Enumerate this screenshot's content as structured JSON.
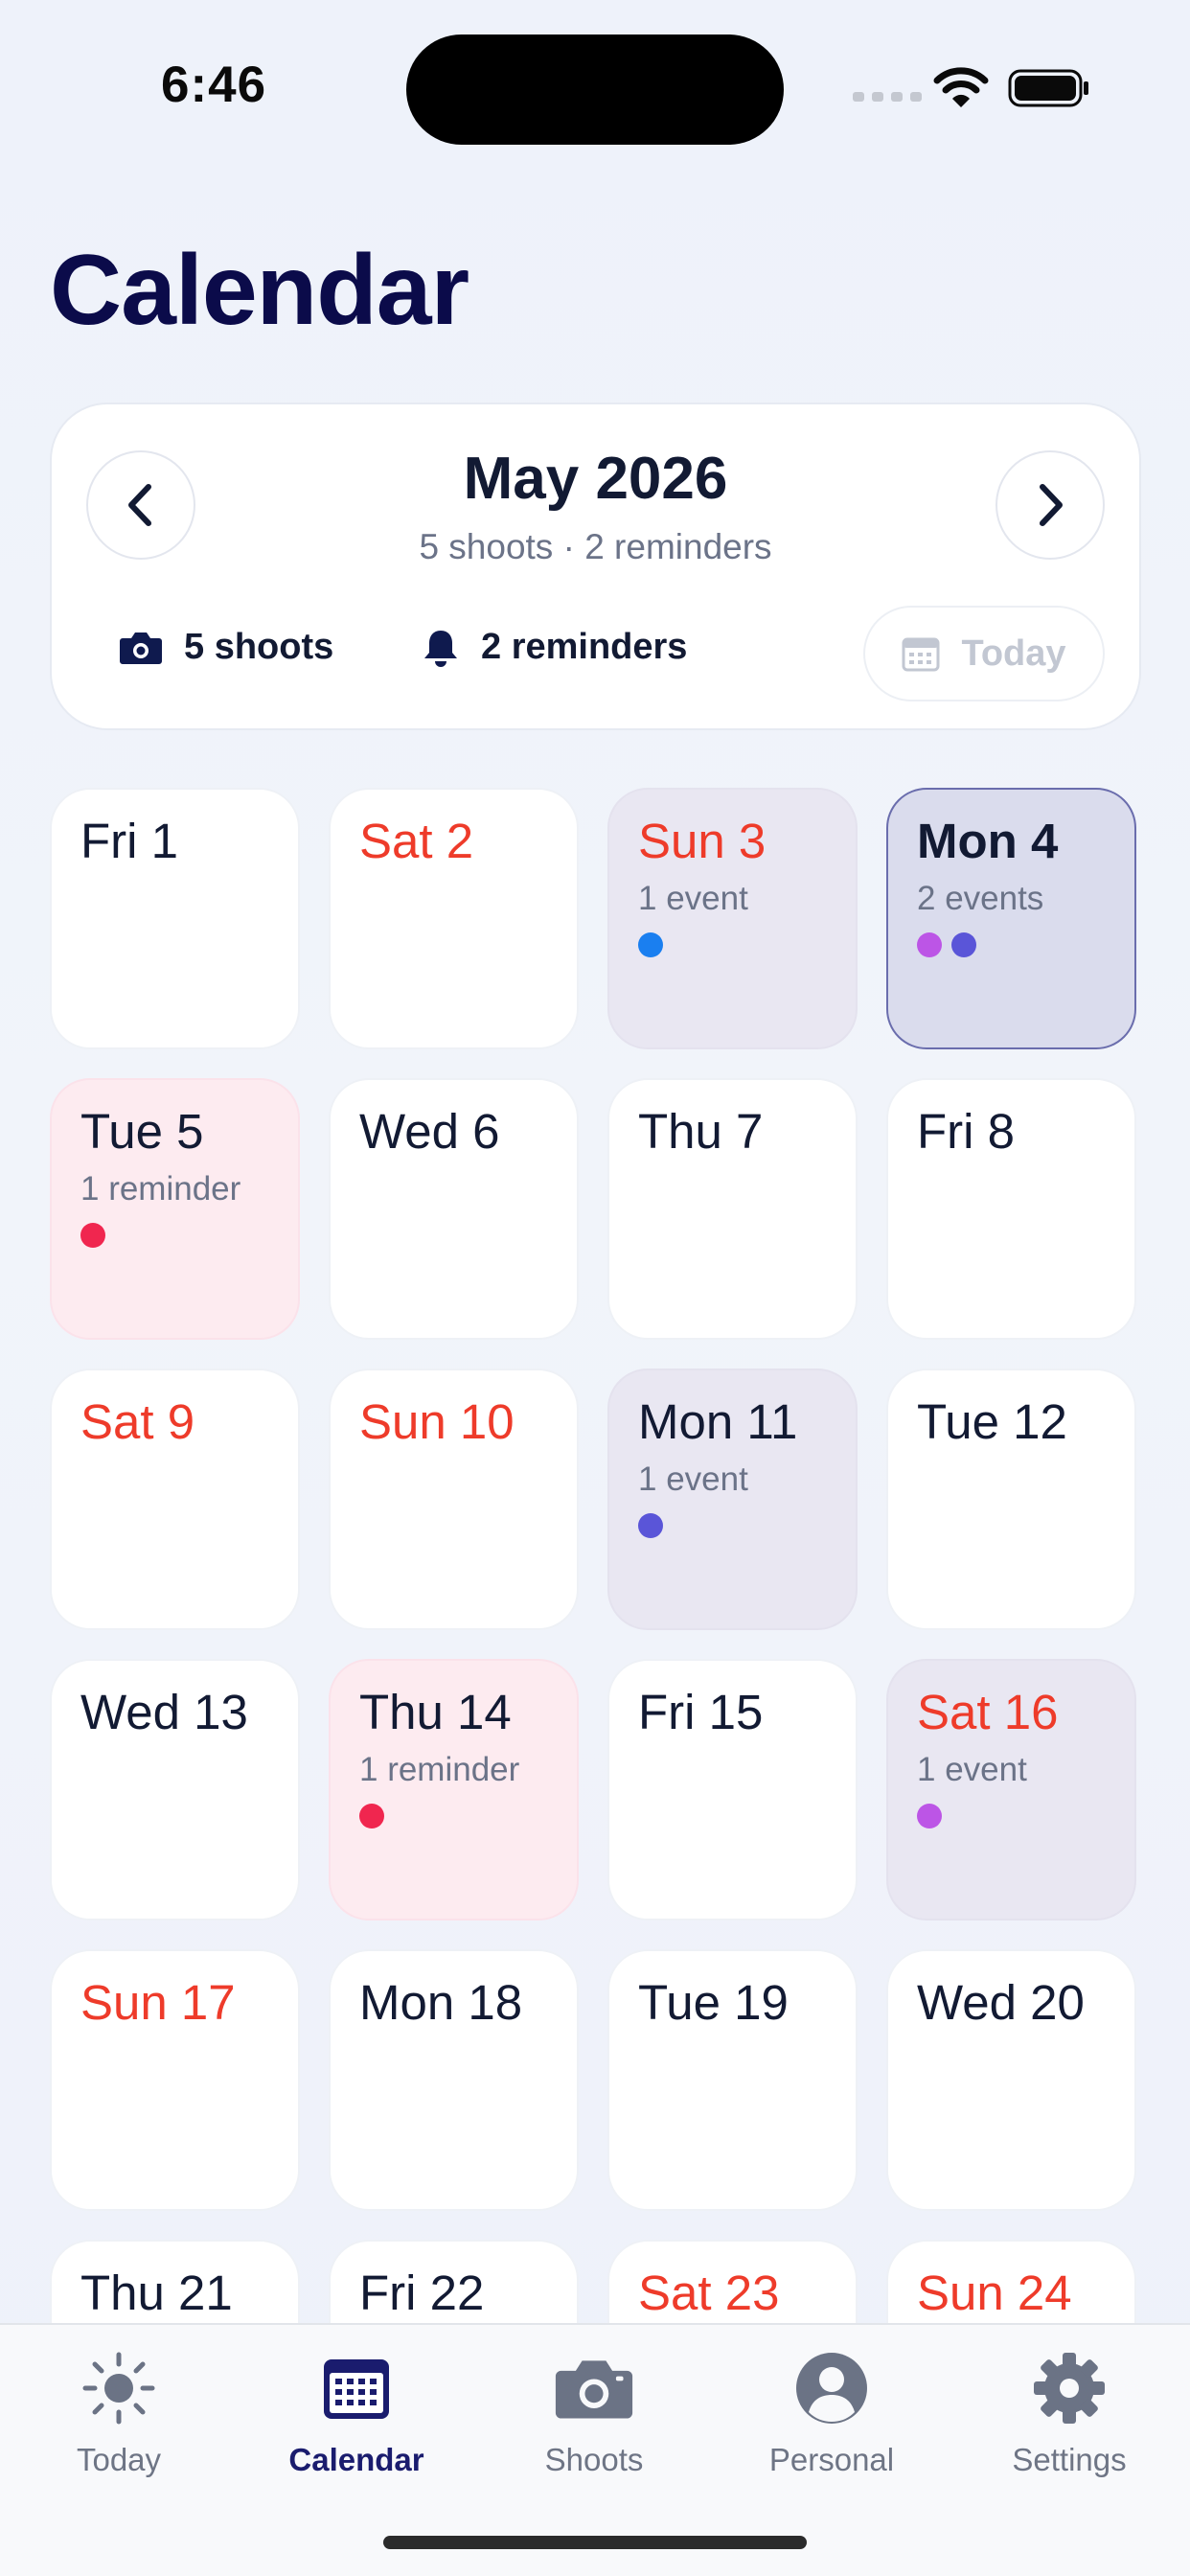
{
  "status_bar": {
    "time": "6:46"
  },
  "header": {
    "title": "Calendar"
  },
  "month_card": {
    "month": "May 2026",
    "subtitle": "5 shoots · 2 reminders",
    "shoots_label": "5 shoots",
    "reminders_label": "2 reminders",
    "today_label": "Today"
  },
  "colors": {
    "event_blue": "#1a7ff0",
    "event_indigo": "#5a55d8",
    "event_purple": "#bc55e6",
    "reminder_red": "#f0264f",
    "weekend_red": "#ee3b2a",
    "selected_border": "#6a6dad"
  },
  "days": [
    {
      "label": "Fri 1",
      "weekend": false,
      "kind": "plain",
      "count": "",
      "dots": []
    },
    {
      "label": "Sat 2",
      "weekend": true,
      "kind": "plain",
      "count": "",
      "dots": []
    },
    {
      "label": "Sun 3",
      "weekend": true,
      "kind": "event",
      "count": "1 event",
      "dots": [
        "#1a7ff0"
      ]
    },
    {
      "label": "Mon 4",
      "weekend": false,
      "kind": "selected",
      "count": "2 events",
      "dots": [
        "#bc55e6",
        "#5a55d8"
      ]
    },
    {
      "label": "Tue 5",
      "weekend": false,
      "kind": "reminder",
      "count": "1 reminder",
      "dots": [
        "#f0264f"
      ]
    },
    {
      "label": "Wed 6",
      "weekend": false,
      "kind": "plain",
      "count": "",
      "dots": []
    },
    {
      "label": "Thu 7",
      "weekend": false,
      "kind": "plain",
      "count": "",
      "dots": []
    },
    {
      "label": "Fri 8",
      "weekend": false,
      "kind": "plain",
      "count": "",
      "dots": []
    },
    {
      "label": "Sat 9",
      "weekend": true,
      "kind": "plain",
      "count": "",
      "dots": []
    },
    {
      "label": "Sun 10",
      "weekend": true,
      "kind": "plain",
      "count": "",
      "dots": []
    },
    {
      "label": "Mon 11",
      "weekend": false,
      "kind": "event",
      "count": "1 event",
      "dots": [
        "#5a55d8"
      ]
    },
    {
      "label": "Tue 12",
      "weekend": false,
      "kind": "plain",
      "count": "",
      "dots": []
    },
    {
      "label": "Wed 13",
      "weekend": false,
      "kind": "plain",
      "count": "",
      "dots": []
    },
    {
      "label": "Thu 14",
      "weekend": false,
      "kind": "reminder",
      "count": "1 reminder",
      "dots": [
        "#f0264f"
      ]
    },
    {
      "label": "Fri 15",
      "weekend": false,
      "kind": "plain",
      "count": "",
      "dots": []
    },
    {
      "label": "Sat 16",
      "weekend": true,
      "kind": "event",
      "count": "1 event",
      "dots": [
        "#bc55e6"
      ]
    },
    {
      "label": "Sun 17",
      "weekend": true,
      "kind": "plain",
      "count": "",
      "dots": []
    },
    {
      "label": "Mon 18",
      "weekend": false,
      "kind": "plain",
      "count": "",
      "dots": []
    },
    {
      "label": "Tue 19",
      "weekend": false,
      "kind": "plain",
      "count": "",
      "dots": []
    },
    {
      "label": "Wed 20",
      "weekend": false,
      "kind": "plain",
      "count": "",
      "dots": []
    },
    {
      "label": "Thu 21",
      "weekend": false,
      "kind": "plain",
      "count": "",
      "dots": []
    },
    {
      "label": "Fri 22",
      "weekend": false,
      "kind": "plain",
      "count": "",
      "dots": []
    },
    {
      "label": "Sat 23",
      "weekend": true,
      "kind": "plain",
      "count": "",
      "dots": []
    },
    {
      "label": "Sun 24",
      "weekend": true,
      "kind": "plain",
      "count": "",
      "dots": []
    }
  ],
  "tabs": [
    {
      "label": "Today",
      "icon": "sun-icon",
      "active": false
    },
    {
      "label": "Calendar",
      "icon": "calendar-icon",
      "active": true
    },
    {
      "label": "Shoots",
      "icon": "camera-icon",
      "active": false
    },
    {
      "label": "Personal",
      "icon": "person-icon",
      "active": false
    },
    {
      "label": "Settings",
      "icon": "gear-icon",
      "active": false
    }
  ]
}
